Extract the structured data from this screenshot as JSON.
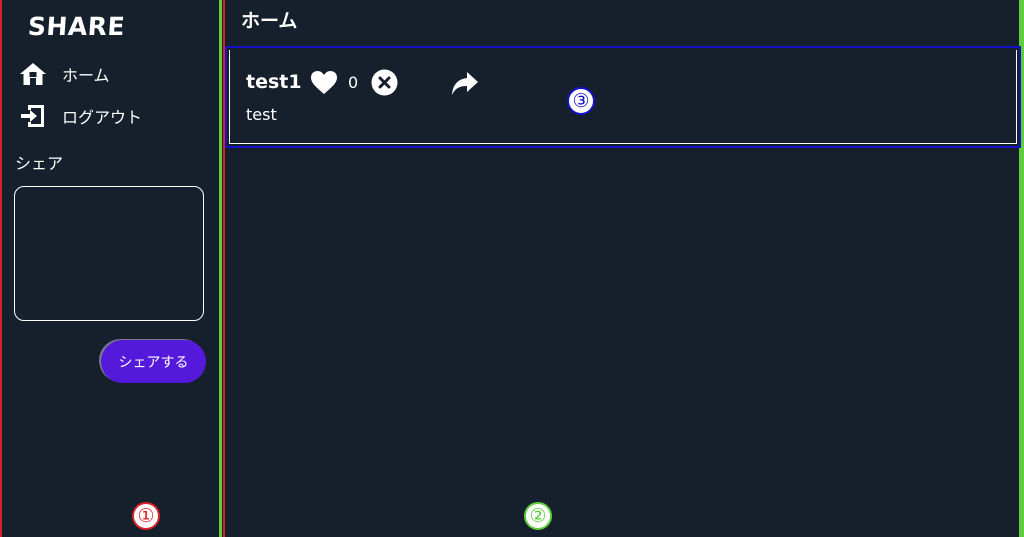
{
  "sidebar": {
    "logo": "SHARE",
    "nav": [
      {
        "label": "ホーム",
        "icon": "home-icon"
      },
      {
        "label": "ログアウト",
        "icon": "logout-icon"
      }
    ],
    "share_heading": "シェア",
    "share_input_value": "",
    "share_button_label": "シェアする"
  },
  "main": {
    "title": "ホーム",
    "posts": [
      {
        "name": "test1",
        "likes": "0",
        "body": "test",
        "icons": [
          "heart-icon",
          "delete-icon",
          "share-icon"
        ]
      }
    ]
  },
  "annotations": {
    "markers": [
      "①",
      "②",
      "③"
    ]
  },
  "colors": {
    "background": "#161f2c",
    "accent_button": "#5419da",
    "region_1": "#d6232a",
    "region_2": "#5fcd3c",
    "region_3": "#1412c8",
    "text": "#ffffff"
  }
}
